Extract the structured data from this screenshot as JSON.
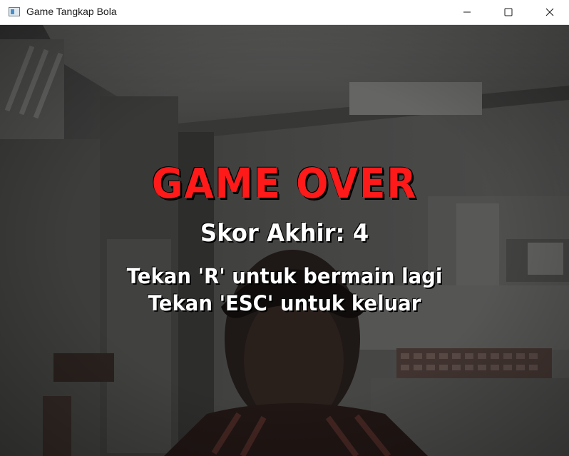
{
  "window": {
    "title": "Game Tangkap Bola"
  },
  "controls": {
    "minimize_icon": "minimize-icon",
    "maximize_icon": "maximize-icon",
    "close_icon": "close-icon"
  },
  "game": {
    "game_over_text": "GAME OVER",
    "final_score_text": "Skor Akhir: 4",
    "restart_hint": "Tekan 'R' untuk bermain lagi",
    "exit_hint": "Tekan 'ESC' untuk keluar"
  },
  "colors": {
    "game_over": "#ff1a1a",
    "text": "#ffffff",
    "outline": "#000000"
  }
}
